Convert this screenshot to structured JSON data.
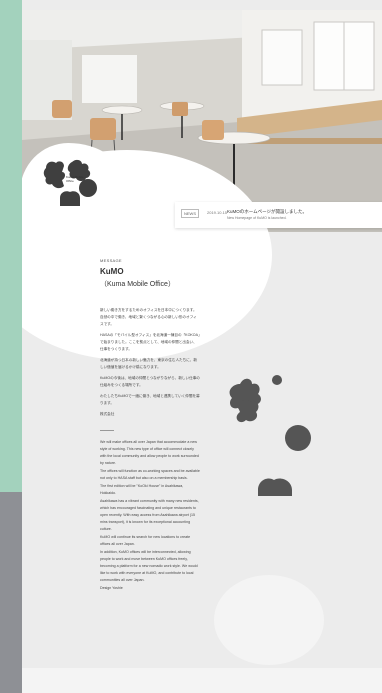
{
  "brand": {
    "name": "KuMO",
    "logo_text": "Kuma Mobile Office"
  },
  "news": {
    "tag": "NEWS",
    "date": "2019.10.15",
    "title": "KuMOのホームページが開設しました。",
    "subtitle": "New Homepage of KuMO is launched."
  },
  "message": {
    "label": "MESSAGE",
    "title": "KuMO",
    "subtitle": "（Kuma Mobile Office）"
  },
  "jp_body": [
    "新しい働き方をするためのオフィスを日本中につくります。自然の中で働き、地域と繋くつながる心の新しい形のオフィスです。",
    "HASAの「モバイル型オフィス」を北海道一棟目の「KOKOA」で始まりました。ここを拠点として、地域の仲間と出会い、仕事をつくります。",
    "北海道が持つ日本の新しい魅力を、東京の住む人たちに、新しい価値を届けるかけ橋になります。",
    "KuMOの今後は、地域の仲間とつながりながら、新しい仕事の仕組みをつくる場所です。",
    "わたしたちKuMOで一緒に働き、地域と連携していく仲間を募ります。"
  ],
  "jp_signature": "株式会社",
  "en_body": [
    "We will make offices all over Japan that accommodate a new style of working. This new type of office will connect closely with the local community and allow people to work surrounded by nature.",
    "The offices will function as co-working spaces and be available not only to HASA staff but also on a membership basis.",
    "The first edition will be \"KoOki House\" in Asahikawa, Hokkaido.",
    "Asahikawa has a vibrant community with many new residents, which has encouraged fascinating and unique restaurants to open recently. With easy access from Asahikawa airport (15 mins transport), it is known for its exceptional accounting culture.",
    "KuMO will continue its search for new locations to create offices all over Japan.",
    "In addition, KuMO offices will be interconnected, allowing people to work and move between KuMO offices freely, becoming a platform for a new nomadic work style. We would like to work with everyone at KuMO, and contribute to local communities all over Japan."
  ],
  "en_signature": "Design Yoshie",
  "colors": {
    "mint": "#a3d2bd",
    "gray_strip": "#8e9095",
    "page_bg": "#ececec",
    "logo": "#3f3f3f"
  }
}
